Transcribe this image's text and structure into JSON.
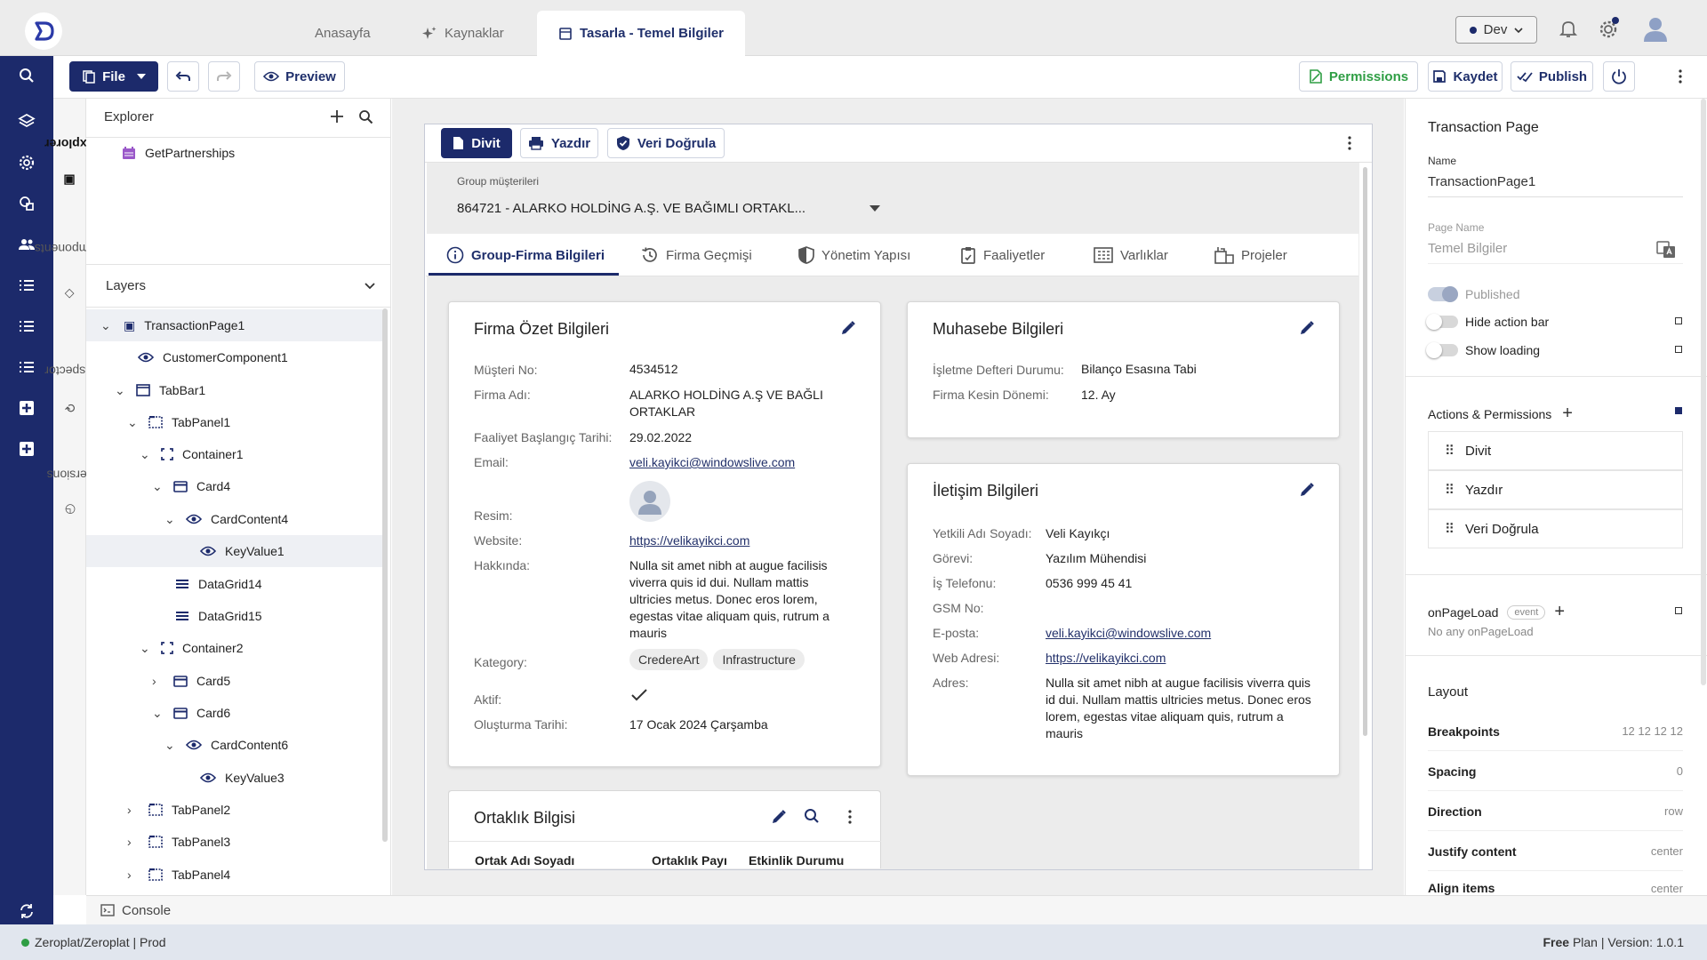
{
  "tabs": [
    {
      "label": "Anasayfa"
    },
    {
      "label": "Kaynaklar"
    },
    {
      "label": "Tasarla - Temel Bilgiler"
    }
  ],
  "env": {
    "label": "Dev"
  },
  "toolbar": {
    "file": "File",
    "preview": "Preview",
    "permissions": "Permissions",
    "save": "Kaydet",
    "publish": "Publish"
  },
  "sidetabs": {
    "explorer": "Explorer",
    "components": "Components",
    "inspector": "Inspector",
    "versions": "Versions"
  },
  "explorer": {
    "title": "Explorer",
    "item": "GetPartnerships"
  },
  "layers": {
    "title": "Layers",
    "items": [
      {
        "label": "TransactionPage1"
      },
      {
        "label": "CustomerComponent1"
      },
      {
        "label": "TabBar1"
      },
      {
        "label": "TabPanel1"
      },
      {
        "label": "Container1"
      },
      {
        "label": "Card4"
      },
      {
        "label": "CardContent4"
      },
      {
        "label": "KeyValue1"
      },
      {
        "label": "DataGrid14"
      },
      {
        "label": "DataGrid15"
      },
      {
        "label": "Container2"
      },
      {
        "label": "Card5"
      },
      {
        "label": "Card6"
      },
      {
        "label": "CardContent6"
      },
      {
        "label": "KeyValue3"
      },
      {
        "label": "TabPanel2"
      },
      {
        "label": "TabPanel3"
      },
      {
        "label": "TabPanel4"
      }
    ]
  },
  "page": {
    "actions": [
      "Divit",
      "Yazdır",
      "Veri Doğrula"
    ],
    "group_label": "Group müşterileri",
    "group_value": "864721 - ALARKO HOLDİNG A.Ş. VE BAĞIMLI ORTAKL...",
    "ftabs": [
      "Group-Firma Bilgileri",
      "Firma Geçmişi",
      "Yönetim Yapısı",
      "Faaliyetler",
      "Varlıklar",
      "Projeler"
    ],
    "summary": {
      "title": "Firma Özet Bilgileri",
      "rows": [
        {
          "label": "Müşteri No:",
          "value": "4534512"
        },
        {
          "label": "Firma Adı:",
          "value": "ALARKO HOLDİNG A.Ş VE BAĞLI ORTAKLAR"
        },
        {
          "label": "Faaliyet Başlangıç Tarihi:",
          "value": "29.02.2022"
        },
        {
          "label": "Email:",
          "value": "veli.kayikci@windowslive.com"
        },
        {
          "label": "Resim:",
          "value": ""
        },
        {
          "label": "Website:",
          "value": "https://velikayikci.com"
        },
        {
          "label": "Hakkında:",
          "value": "Nulla sit amet nibh at augue facilisis viverra quis id dui. Nullam mattis ultricies metus. Donec eros lorem, egestas vitae aliquam quis, rutrum a mauris"
        },
        {
          "label": "Kategory:",
          "value": ""
        },
        {
          "label": "Aktif:",
          "value": ""
        },
        {
          "label": "Oluşturma Tarihi:",
          "value": "17 Ocak 2024 Çarşamba"
        }
      ],
      "chips": [
        "CredereArt",
        "Infrastructure"
      ]
    },
    "accounting": {
      "title": "Muhasebe Bilgileri",
      "rows": [
        {
          "label": "İşletme Defteri Durumu:",
          "value": "Bilanço Esasına Tabi"
        },
        {
          "label": "Firma Kesin Dönemi:",
          "value": "12. Ay"
        }
      ]
    },
    "contact": {
      "title": "İletişim Bilgileri",
      "rows": [
        {
          "label": "Yetkili Adı Soyadı:",
          "value": "Veli Kayıkçı"
        },
        {
          "label": "Görevi:",
          "value": "Yazılım Mühendisi"
        },
        {
          "label": "İş Telefonu:",
          "value": "0536 999 45 41"
        },
        {
          "label": "GSM No:",
          "value": ""
        },
        {
          "label": "E-posta:",
          "value": "veli.kayikci@windowslive.com"
        },
        {
          "label": "Web Adresi:",
          "value": "https://velikayikci.com"
        },
        {
          "label": "Adres:",
          "value": "Nulla sit amet nibh at augue facilisis viverra quis id dui. Nullam mattis ultricies metus. Donec eros lorem, egestas vitae aliquam quis, rutrum a mauris"
        }
      ]
    },
    "partners": {
      "title": "Ortaklık Bilgisi",
      "columns": [
        "Ortak Adı Soyadı",
        "Ortaklık Payı",
        "Etkinlik Durumu"
      ]
    }
  },
  "props": {
    "title": "Transaction Page",
    "name_label": "Name",
    "name_value": "TransactionPage1",
    "pagename_label": "Page Name",
    "pagename_value": "Temel Bilgiler",
    "published": "Published",
    "hide_action_bar": "Hide action bar",
    "show_loading": "Show loading",
    "actions_title": "Actions & Permissions",
    "actions": [
      "Divit",
      "Yazdır",
      "Veri Doğrula"
    ],
    "onpageload": "onPageLoad",
    "event_badge": "event",
    "onpageload_empty": "No any onPageLoad",
    "layout_title": "Layout",
    "layout": [
      {
        "label": "Breakpoints",
        "value": "12 12 12 12"
      },
      {
        "label": "Spacing",
        "value": "0"
      },
      {
        "label": "Direction",
        "value": "row"
      },
      {
        "label": "Justify content",
        "value": "center"
      },
      {
        "label": "Align items",
        "value": "center"
      }
    ]
  },
  "console": "Console",
  "status": {
    "left": "Zeroplat/Zeroplat | Prod",
    "plan_bold": "Free",
    "plan_rest": "Plan | Version: 1.0.1"
  },
  "colors": {
    "brand": "#1c2a6b",
    "accent": "#2f9e44",
    "link": "#22306a"
  }
}
